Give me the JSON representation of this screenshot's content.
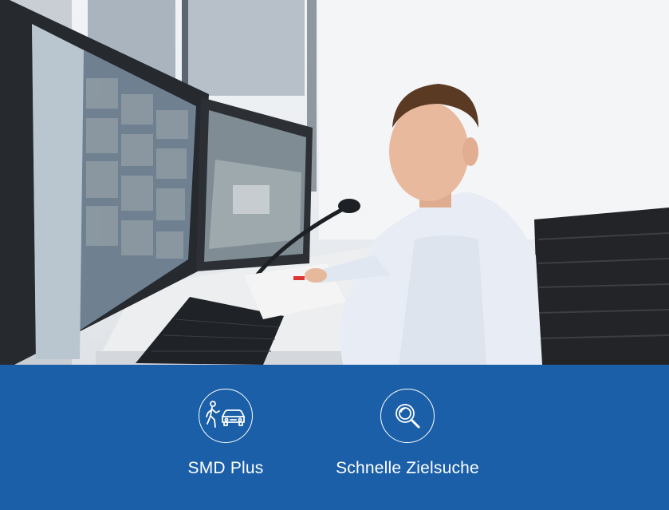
{
  "hero": {
    "icon": "surveillance-operator-photo"
  },
  "features": {
    "band_color": "#1a5fa8",
    "items": [
      {
        "icon": "person-and-car-icon",
        "label": "SMD Plus"
      },
      {
        "icon": "magnifier-icon",
        "label": "Schnelle Zielsuche"
      }
    ]
  }
}
